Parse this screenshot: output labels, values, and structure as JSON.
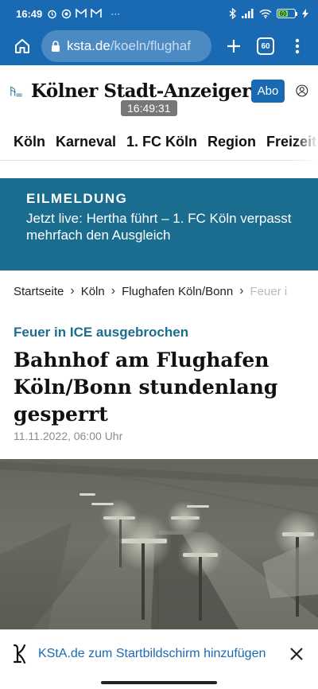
{
  "status_bar": {
    "time": "16:49",
    "more": "···",
    "battery": "60"
  },
  "browser": {
    "url_host": "ksta.de",
    "url_path": "/koeln/flughaf",
    "tab_count": "60"
  },
  "site": {
    "masthead": "Kölner Stadt-Anzeiger",
    "abo_label": "Abo",
    "time_tooltip": "16:49:31"
  },
  "nav": {
    "items": [
      "Köln",
      "Karneval",
      "1. FC Köln",
      "Region",
      "Freizeit"
    ]
  },
  "breaking": {
    "label": "EILMELDUNG",
    "text": "Jetzt live: Hertha führt – 1. FC Köln verpasst mehrfach den Ausgleich"
  },
  "breadcrumb": {
    "items": [
      "Startseite",
      "Köln",
      "Flughafen Köln/Bonn",
      "Feuer i"
    ]
  },
  "article": {
    "kicker": "Feuer in ICE ausgebrochen",
    "headline": "Bahnhof am Flughafen Köln/Bonn stundenlang gesperrt",
    "date": "11.11.2022, 06:00 Uhr"
  },
  "install_banner": {
    "text": "KStA.de zum Startbildschirm hinzufügen"
  },
  "colors": {
    "chrome": "#1a6ab3",
    "breaking": "#1b6d8f",
    "accent": "#1a6ab3"
  }
}
